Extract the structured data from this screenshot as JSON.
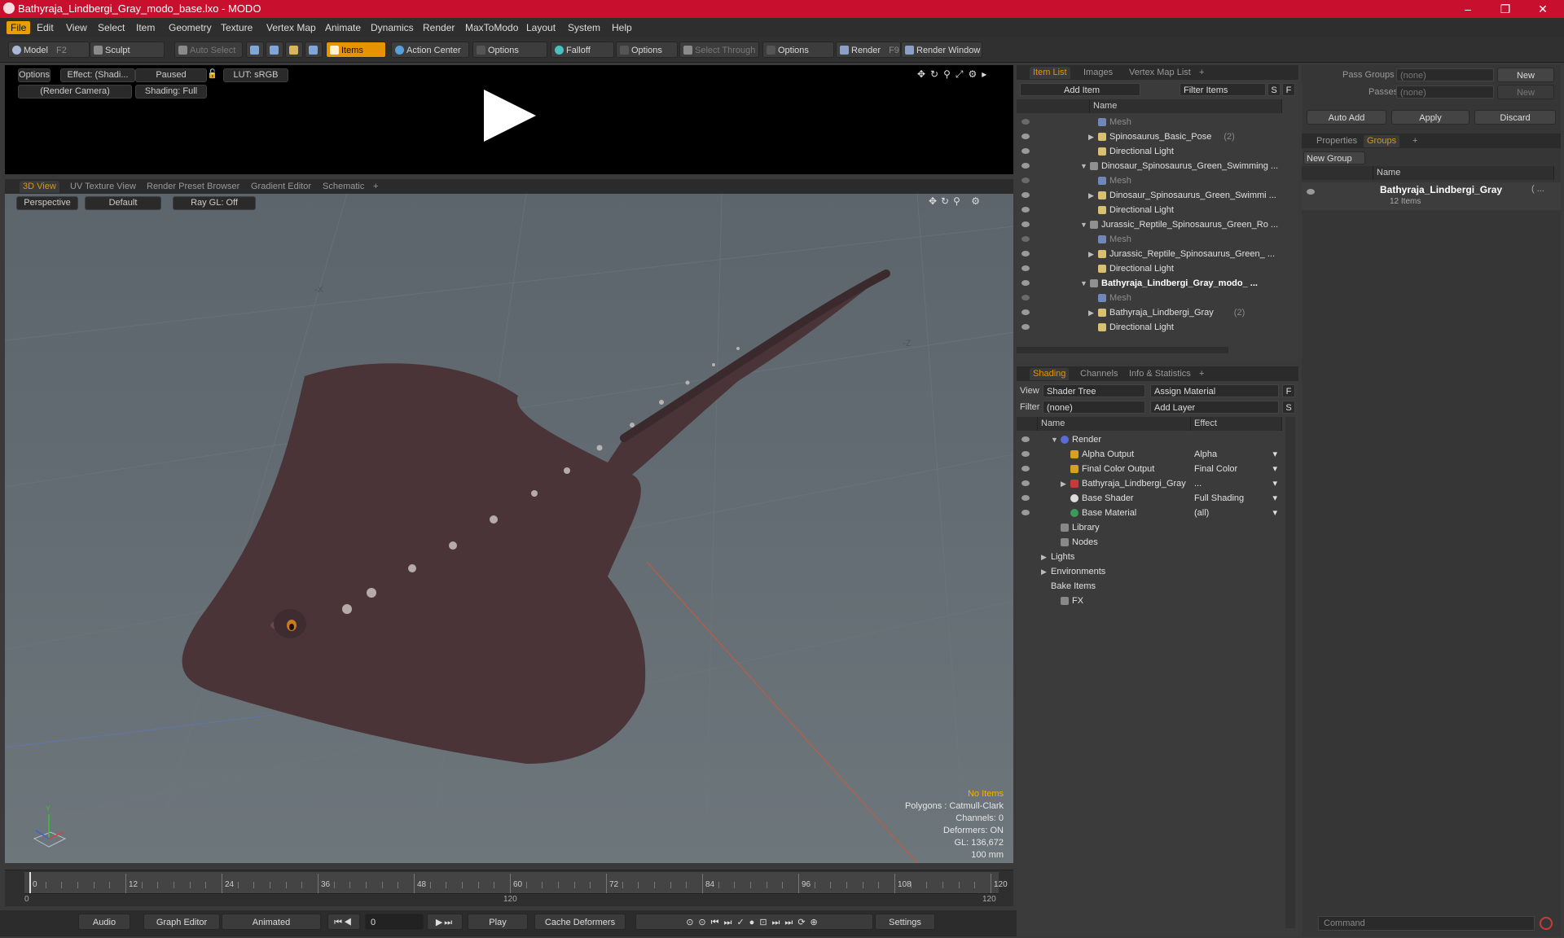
{
  "window": {
    "title": "Bathyraja_Lindbergi_Gray_modo_base.lxo - MODO",
    "minimize": "–",
    "maximize": "❐",
    "close": "✕"
  },
  "menu": [
    "File",
    "Edit",
    "View",
    "Select",
    "Item",
    "Geometry",
    "Texture",
    "Vertex Map",
    "Animate",
    "Dynamics",
    "Render",
    "MaxToModo",
    "Layout",
    "System",
    "Help"
  ],
  "toolbar": {
    "model": "Model",
    "model_key": "F2",
    "sculpt": "Sculpt",
    "auto_select": "Auto Select",
    "items": "Items",
    "action_center": "Action Center",
    "options1": "Options",
    "falloff": "Falloff",
    "options2": "Options",
    "select_through": "Select Through",
    "options3": "Options",
    "render": "Render",
    "render_key": "F9",
    "render_window": "Render Window"
  },
  "render_preview": {
    "options": "Options",
    "effect": "Effect: (Shadi...",
    "paused": "Paused",
    "lut": "LUT: sRGB",
    "camera": "(Render Camera)",
    "shading": "Shading: Full"
  },
  "viewport_tabs": [
    "3D View",
    "UV Texture View",
    "Render Preset Browser",
    "Gradient Editor",
    "Schematic",
    "+"
  ],
  "view3d": {
    "perspective": "Perspective",
    "default": "Default",
    "raygl": "Ray GL: Off",
    "axis_x": "-X",
    "axis_z": "-Z",
    "axis_y": "Y",
    "stats": {
      "no_items": "No Items",
      "polygons": "Polygons : Catmull-Clark",
      "channels": "Channels: 0",
      "deformers": "Deformers: ON",
      "gl": "GL: 136,672",
      "scale": "100 mm"
    }
  },
  "timeline": {
    "ticks": [
      "0",
      "12",
      "24",
      "36",
      "48",
      "60",
      "72",
      "84",
      "96",
      "108",
      "120"
    ],
    "start": "0",
    "end": "120",
    "center": "120"
  },
  "transport": {
    "audio": "Audio",
    "graph_editor": "Graph Editor",
    "animated": "Animated",
    "frame": "0",
    "play": "Play",
    "cache_deformers": "Cache Deformers",
    "settings": "Settings"
  },
  "item_list": {
    "tabs": [
      "Item List",
      "Images",
      "Vertex Map List",
      "+"
    ],
    "add_item": "Add Item",
    "filter": "Filter Items",
    "s": "S",
    "f": "F",
    "name_header": "Name",
    "rows": [
      {
        "label": "Mesh",
        "indent": 2,
        "style": "dim",
        "arrow": ""
      },
      {
        "label": "Spinosaurus_Basic_Pose",
        "count": "(2)",
        "indent": 2,
        "style": "",
        "arrow": "▶"
      },
      {
        "label": "Directional Light",
        "indent": 2,
        "style": "",
        "arrow": ""
      },
      {
        "label": "Dinosaur_Spinosaurus_Green_Swimming ...",
        "indent": 1,
        "style": "",
        "arrow": "▼"
      },
      {
        "label": "Mesh",
        "indent": 2,
        "style": "dim",
        "arrow": ""
      },
      {
        "label": "Dinosaur_Spinosaurus_Green_Swimmi ...",
        "indent": 2,
        "style": "",
        "arrow": "▶"
      },
      {
        "label": "Directional Light",
        "indent": 2,
        "style": "",
        "arrow": ""
      },
      {
        "label": "Jurassic_Reptile_Spinosaurus_Green_Ro ...",
        "indent": 1,
        "style": "",
        "arrow": "▼"
      },
      {
        "label": "Mesh",
        "indent": 2,
        "style": "dim",
        "arrow": ""
      },
      {
        "label": "Jurassic_Reptile_Spinosaurus_Green_ ...",
        "indent": 2,
        "style": "",
        "arrow": "▶"
      },
      {
        "label": "Directional Light",
        "indent": 2,
        "style": "",
        "arrow": ""
      },
      {
        "label": "Bathyraja_Lindbergi_Gray_modo_ ...",
        "indent": 1,
        "style": "bold",
        "arrow": "▼"
      },
      {
        "label": "Mesh",
        "indent": 2,
        "style": "dim",
        "arrow": ""
      },
      {
        "label": "Bathyraja_Lindbergi_Gray",
        "count": "(2)",
        "indent": 2,
        "style": "",
        "arrow": "▶"
      },
      {
        "label": "Directional Light",
        "indent": 2,
        "style": "",
        "arrow": ""
      }
    ]
  },
  "shading": {
    "tabs": [
      "Shading",
      "Channels",
      "Info & Statistics",
      "+"
    ],
    "view_label": "View",
    "view_value": "Shader Tree",
    "assign_material": "Assign Material",
    "filter_label": "Filter",
    "filter_value": "(none)",
    "add_layer": "Add Layer",
    "f": "F",
    "s": "S",
    "col_name": "Name",
    "col_effect": "Effect",
    "rows": [
      {
        "label": "Render",
        "effect": "",
        "indent": 1,
        "arrow": "▼",
        "icon": "#5a6bd6"
      },
      {
        "label": "Alpha Output",
        "effect": "Alpha",
        "indent": 2,
        "arrow": "",
        "icon": "#d8a020"
      },
      {
        "label": "Final Color Output",
        "effect": "Final Color",
        "indent": 2,
        "arrow": "",
        "icon": "#d8a020"
      },
      {
        "label": "Bathyraja_Lindbergi_Gray",
        "effect": "...",
        "indent": 2,
        "arrow": "▶",
        "icon": "#c83a3a"
      },
      {
        "label": "Base Shader",
        "effect": "Full Shading",
        "indent": 2,
        "arrow": "",
        "icon": "#dddddd"
      },
      {
        "label": "Base Material",
        "effect": "(all)",
        "indent": 2,
        "arrow": "",
        "icon": "#3a9a5a"
      },
      {
        "label": "Library",
        "effect": "",
        "indent": 1,
        "arrow": "",
        "icon": "#888888"
      },
      {
        "label": "Nodes",
        "effect": "",
        "indent": 1,
        "arrow": "",
        "icon": "#888888"
      },
      {
        "label": "Lights",
        "effect": "",
        "indent": 0,
        "arrow": "▶",
        "icon": ""
      },
      {
        "label": "Environments",
        "effect": "",
        "indent": 0,
        "arrow": "▶",
        "icon": ""
      },
      {
        "label": "Bake Items",
        "effect": "",
        "indent": 0,
        "arrow": "",
        "icon": ""
      },
      {
        "label": "FX",
        "effect": "",
        "indent": 1,
        "arrow": "",
        "icon": "#888888"
      }
    ]
  },
  "groups_panel": {
    "pass_groups": "Pass Groups",
    "pass_groups_value": "(none)",
    "new": "New",
    "passes": "Passes",
    "passes_value": "(none)",
    "new2": "New",
    "auto_add": "Auto Add",
    "apply": "Apply",
    "discard": "Discard",
    "tabs": [
      "Properties",
      "Groups",
      "+"
    ],
    "new_group": "New Group",
    "name_header": "Name",
    "group_name": "Bathyraja_Lindbergi_Gray",
    "group_more": "( ...",
    "group_count": "12 Items"
  },
  "command": {
    "placeholder": "Command"
  },
  "colors": {
    "accent": "#e59400",
    "titlebar": "#c8102e",
    "ray_body": "#4a3438"
  }
}
